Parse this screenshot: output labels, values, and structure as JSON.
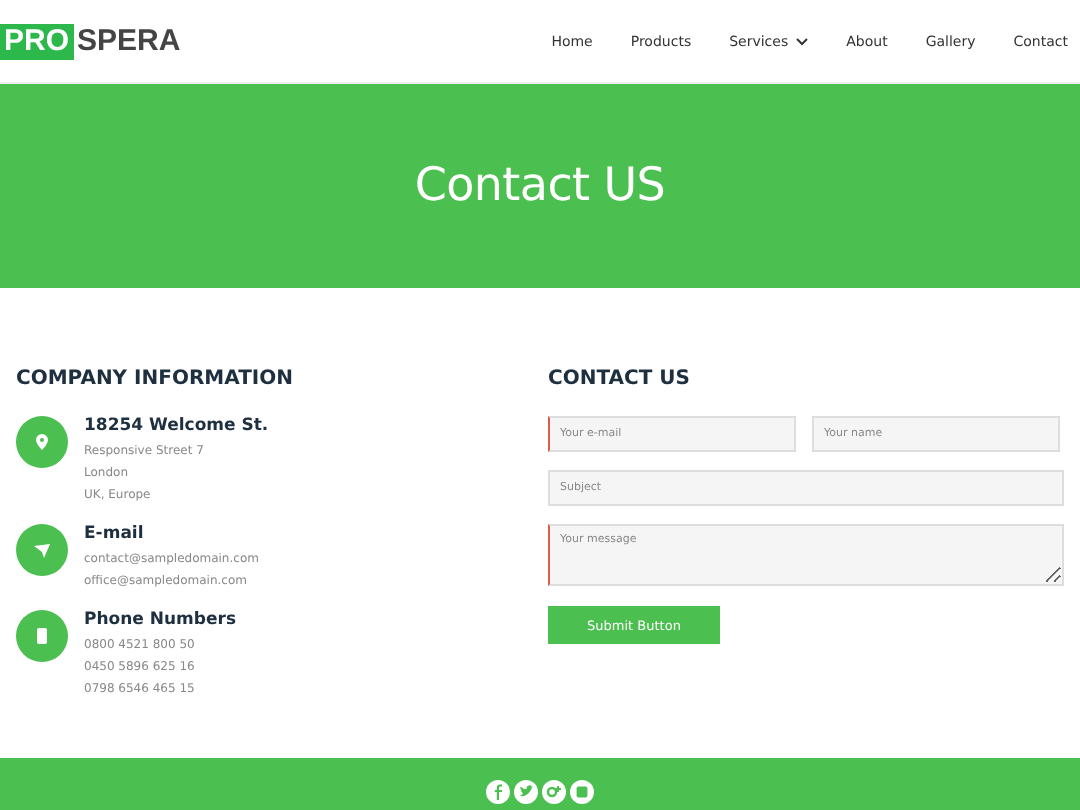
{
  "logo": {
    "highlight": "PRO",
    "rest": "SPERA"
  },
  "nav": [
    {
      "label": "Home",
      "dropdown": false
    },
    {
      "label": "Products",
      "dropdown": false
    },
    {
      "label": "Services",
      "dropdown": true
    },
    {
      "label": "About",
      "dropdown": false
    },
    {
      "label": "Gallery",
      "dropdown": false
    },
    {
      "label": "Contact",
      "dropdown": false
    }
  ],
  "hero": {
    "title": "Contact US"
  },
  "company": {
    "heading": "COMPANY INFORMATION",
    "items": [
      {
        "kind": "address",
        "title": "18254 Welcome St.",
        "lines": [
          "Responsive Street 7",
          "London",
          "UK, Europe"
        ]
      },
      {
        "kind": "email",
        "title": "E-mail",
        "lines": [
          "contact@sampledomain.com",
          "office@sampledomain.com"
        ]
      },
      {
        "kind": "phone",
        "title": "Phone Numbers",
        "lines": [
          "0800 4521 800 50",
          "0450 5896 625 16",
          "0798 6546 465 15"
        ]
      }
    ]
  },
  "contact": {
    "heading": "CONTACT US",
    "fields": [
      {
        "placeholder": "Your e-mail",
        "required": true,
        "kind": "half"
      },
      {
        "placeholder": "Your name",
        "required": false,
        "kind": "half"
      },
      {
        "placeholder": "Subject",
        "required": false,
        "kind": "full"
      },
      {
        "placeholder": "Your message",
        "required": true,
        "kind": "textarea"
      }
    ],
    "submit": "Submit Button"
  },
  "footer": {
    "social": [
      {
        "kind": "facebook"
      },
      {
        "kind": "twitter"
      },
      {
        "kind": "googleplus"
      },
      {
        "kind": "other"
      }
    ]
  }
}
